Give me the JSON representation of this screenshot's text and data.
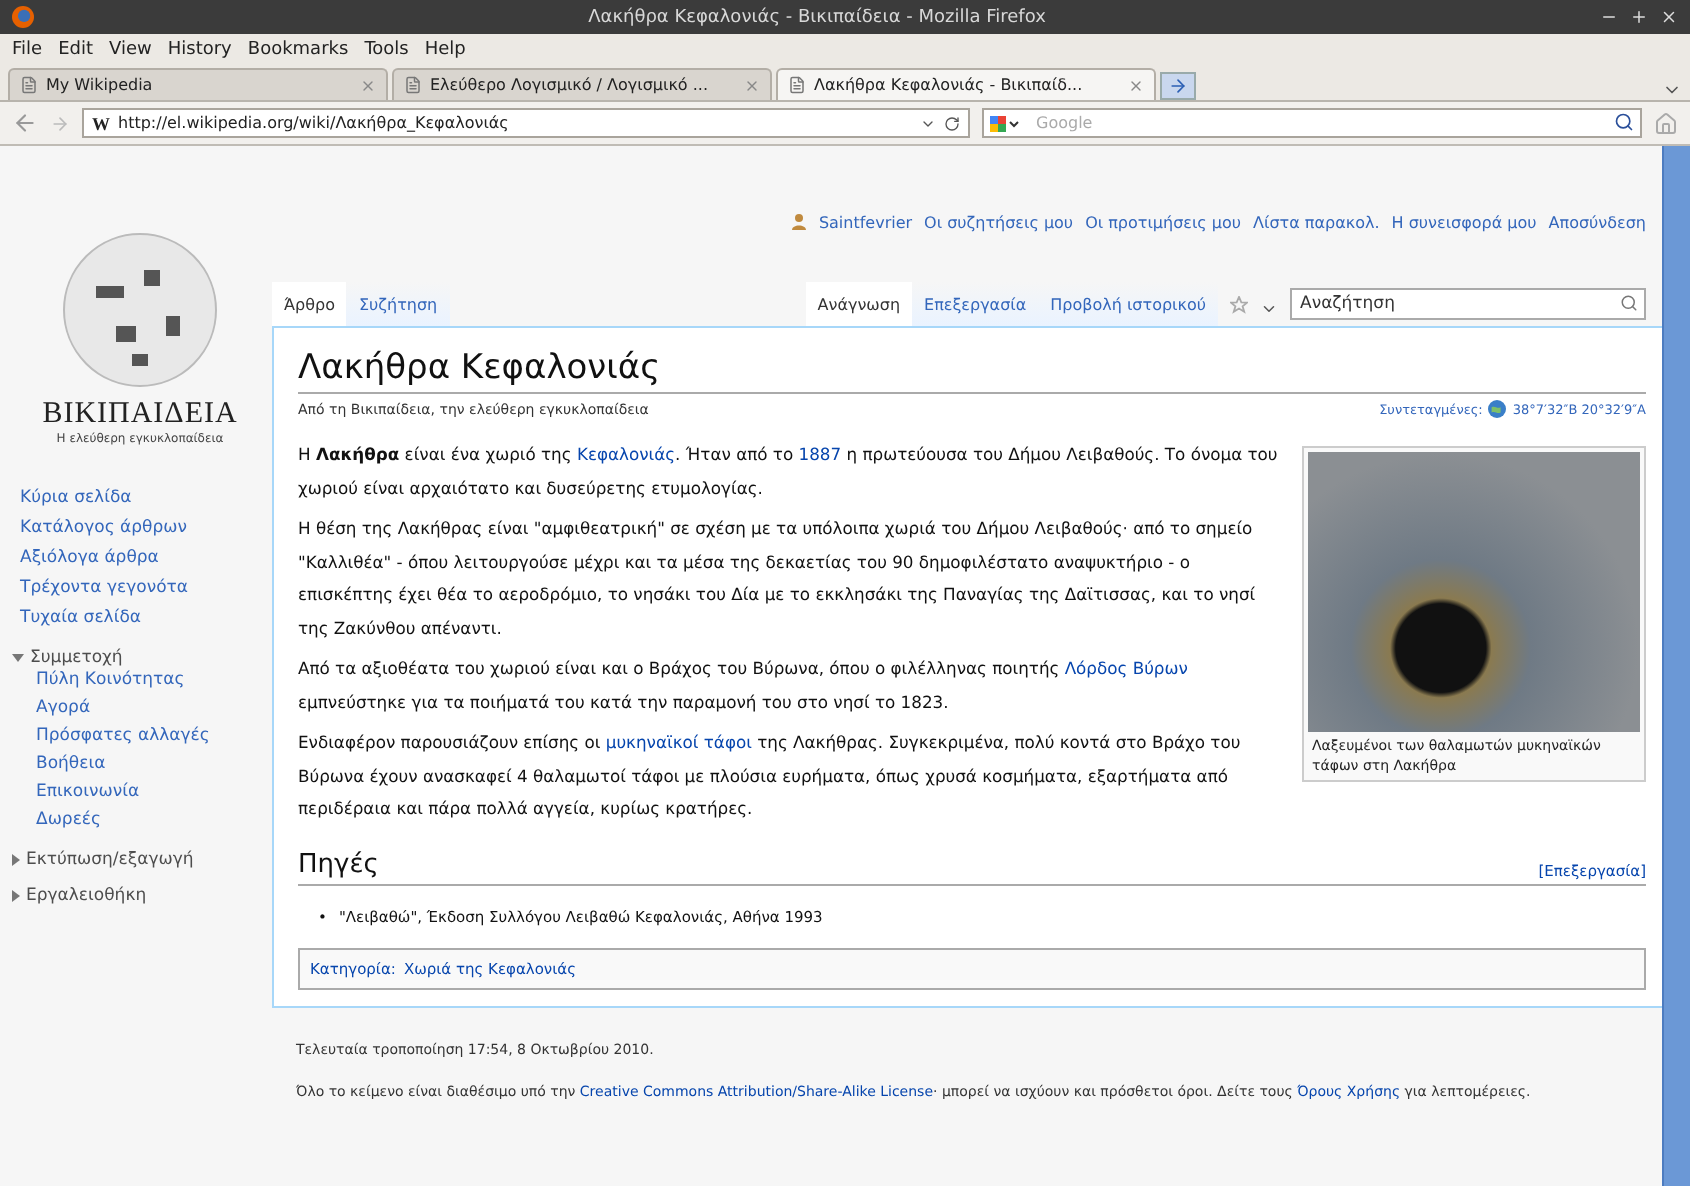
{
  "window": {
    "title": "Λακήθρα Κεφαλονιάς - Βικιπαίδεια - Mozilla Firefox"
  },
  "menu": [
    "File",
    "Edit",
    "View",
    "History",
    "Bookmarks",
    "Tools",
    "Help"
  ],
  "browser_tabs": [
    {
      "label": "My Wikipedia",
      "selected": false
    },
    {
      "label": "Ελεύθερο Λογισμικό / Λογισμικό ...",
      "selected": false
    },
    {
      "label": "Λακήθρα Κεφαλονιάς - Βικιπαίδ...",
      "selected": true
    }
  ],
  "address": {
    "favicon": "W",
    "value": "http://el.wikipedia.org/wiki/Λακήθρα_Κεφαλονιάς"
  },
  "web_search": {
    "placeholder": "Google"
  },
  "personal_links": [
    "Saintfevrier",
    "Οι συζητήσεις μου",
    "Οι προτιμήσεις μου",
    "Λίστα παρακολ.",
    "Η συνεισφορά μου",
    "Αποσύνδεση"
  ],
  "logo": {
    "wordmark": "ΒΙΚΙΠΑΙΔΕΙΑ",
    "tagline": "Η ελεύθερη εγκυκλοπαίδεια"
  },
  "page_tabs": [
    {
      "label": "Άρθρο",
      "selected": true
    },
    {
      "label": "Συζήτηση",
      "selected": false
    }
  ],
  "views": [
    {
      "label": "Ανάγνωση",
      "selected": true
    },
    {
      "label": "Επεξεργασία",
      "selected": false
    },
    {
      "label": "Προβολή ιστορικού",
      "selected": false
    }
  ],
  "wiki_search": {
    "placeholder": "Αναζήτηση"
  },
  "navigation": [
    "Κύρια σελίδα",
    "Κατάλογος άρθρων",
    "Αξιόλογα άρθρα",
    "Τρέχοντα γεγονότα",
    "Τυχαία σελίδα"
  ],
  "portals": [
    {
      "label": "Συμμετοχή",
      "expanded": true,
      "items": [
        "Πύλη Κοινότητας",
        "Αγορά",
        "Πρόσφατες αλλαγές",
        "Βοήθεια",
        "Επικοινωνία",
        "Δωρεές"
      ]
    },
    {
      "label": "Εκτύπωση/εξαγωγή",
      "expanded": false
    },
    {
      "label": "Εργαλειοθήκη",
      "expanded": false
    }
  ],
  "article": {
    "title": "Λακήθρα Κεφαλονιάς",
    "subtitle": "Από τη Βικιπαίδεια, την ελεύθερη εγκυκλοπαίδεια",
    "coordinates_label": "Συντεταγμένες:",
    "coordinates": "38°7′32″Β 20°32′9″Α",
    "paragraphs": [
      [
        {
          "kind": "text",
          "text": "Η "
        },
        {
          "kind": "bold",
          "text": "Λακήθρα"
        },
        {
          "kind": "text",
          "text": " είναι ένα χωριό της "
        },
        {
          "kind": "link",
          "text": "Κεφαλονιάς"
        },
        {
          "kind": "text",
          "text": ". Ήταν από το "
        },
        {
          "kind": "link",
          "text": "1887"
        },
        {
          "kind": "text",
          "text": " η πρωτεύουσα του Δήμου Λειβαθούς. Το όνομα του χωριού είναι αρχαιότατο και δυσεύρετης ετυμολογίας."
        }
      ],
      [
        {
          "kind": "text",
          "text": "Η θέση της Λακήθρας είναι \"αμφιθεατρική\" σε σχέση με τα υπόλοιπα χωριά του Δήμου Λειβαθούς· από το σημείο \"Καλλιθέα\" - όπου λειτουργούσε μέχρι και τα μέσα της δεκαετίας του 90 δημοφιλέστατο αναψυκτήριο - ο επισκέπτης έχει θέα το αεροδρόμιο, το νησάκι του Δία με το εκκλησάκι της Παναγίας της Δαϊτισσας, και το νησί της Ζακύνθου απέναντι."
        }
      ],
      [
        {
          "kind": "text",
          "text": "Από τα αξιοθέατα του χωριού είναι και ο Βράχος του Βύρωνα, όπου ο φιλέλληνας ποιητής "
        },
        {
          "kind": "link",
          "text": "Λόρδος Βύρων"
        },
        {
          "kind": "text",
          "text": " εμπνεύστηκε για τα ποιήματά του κατά την παραμονή του στο νησί το 1823."
        }
      ],
      [
        {
          "kind": "text",
          "text": "Ενδιαφέρον παρουσιάζουν επίσης οι "
        },
        {
          "kind": "link",
          "text": "μυκηναϊκοί τάφοι"
        },
        {
          "kind": "text",
          "text": " της Λακήθρας. Συγκεκριμένα, πολύ κοντά στο Βράχο του Βύρωνα έχουν ανασκαφεί 4 θαλαμωτοί τάφοι με πλούσια ευρήματα, όπως χρυσά κοσμήματα, εξαρτήματα από περιδέραια και πάρα πολλά αγγεία, κυρίως κρατήρες."
        }
      ]
    ],
    "figure_caption": "Λαξευμένοι των θαλαμωτών μυκηναϊκών τάφων στη Λακήθρα",
    "section": {
      "title": "Πηγές",
      "edit": "[Επεξεργασία]",
      "references": [
        {
          "marker": "•",
          "text": "\"Λειβαθώ\", Έκδοση Συλλόγου Λειβαθώ Κεφαλονιάς, Αθήνα 1993"
        }
      ]
    },
    "category_label": "Κατηγορία:",
    "categories": [
      "Χωριά της Κεφαλονιάς"
    ]
  },
  "footer": {
    "modified": "Τελευταία τροποποίηση 17:54, 8 Οκτωβρίου 2010.",
    "license": [
      {
        "kind": "text",
        "text": "Όλο το κείμενο είναι διαθέσιμο υπό την "
      },
      {
        "kind": "link",
        "text": "Creative Commons Attribution/Share-Alike License"
      },
      {
        "kind": "text",
        "text": "· μπορεί να ισχύουν και πρόσθετοι όροι. Δείτε τους "
      },
      {
        "kind": "link",
        "text": "Όρους Χρήσης"
      },
      {
        "kind": "text",
        "text": " για λεπτομέρειες."
      }
    ]
  }
}
